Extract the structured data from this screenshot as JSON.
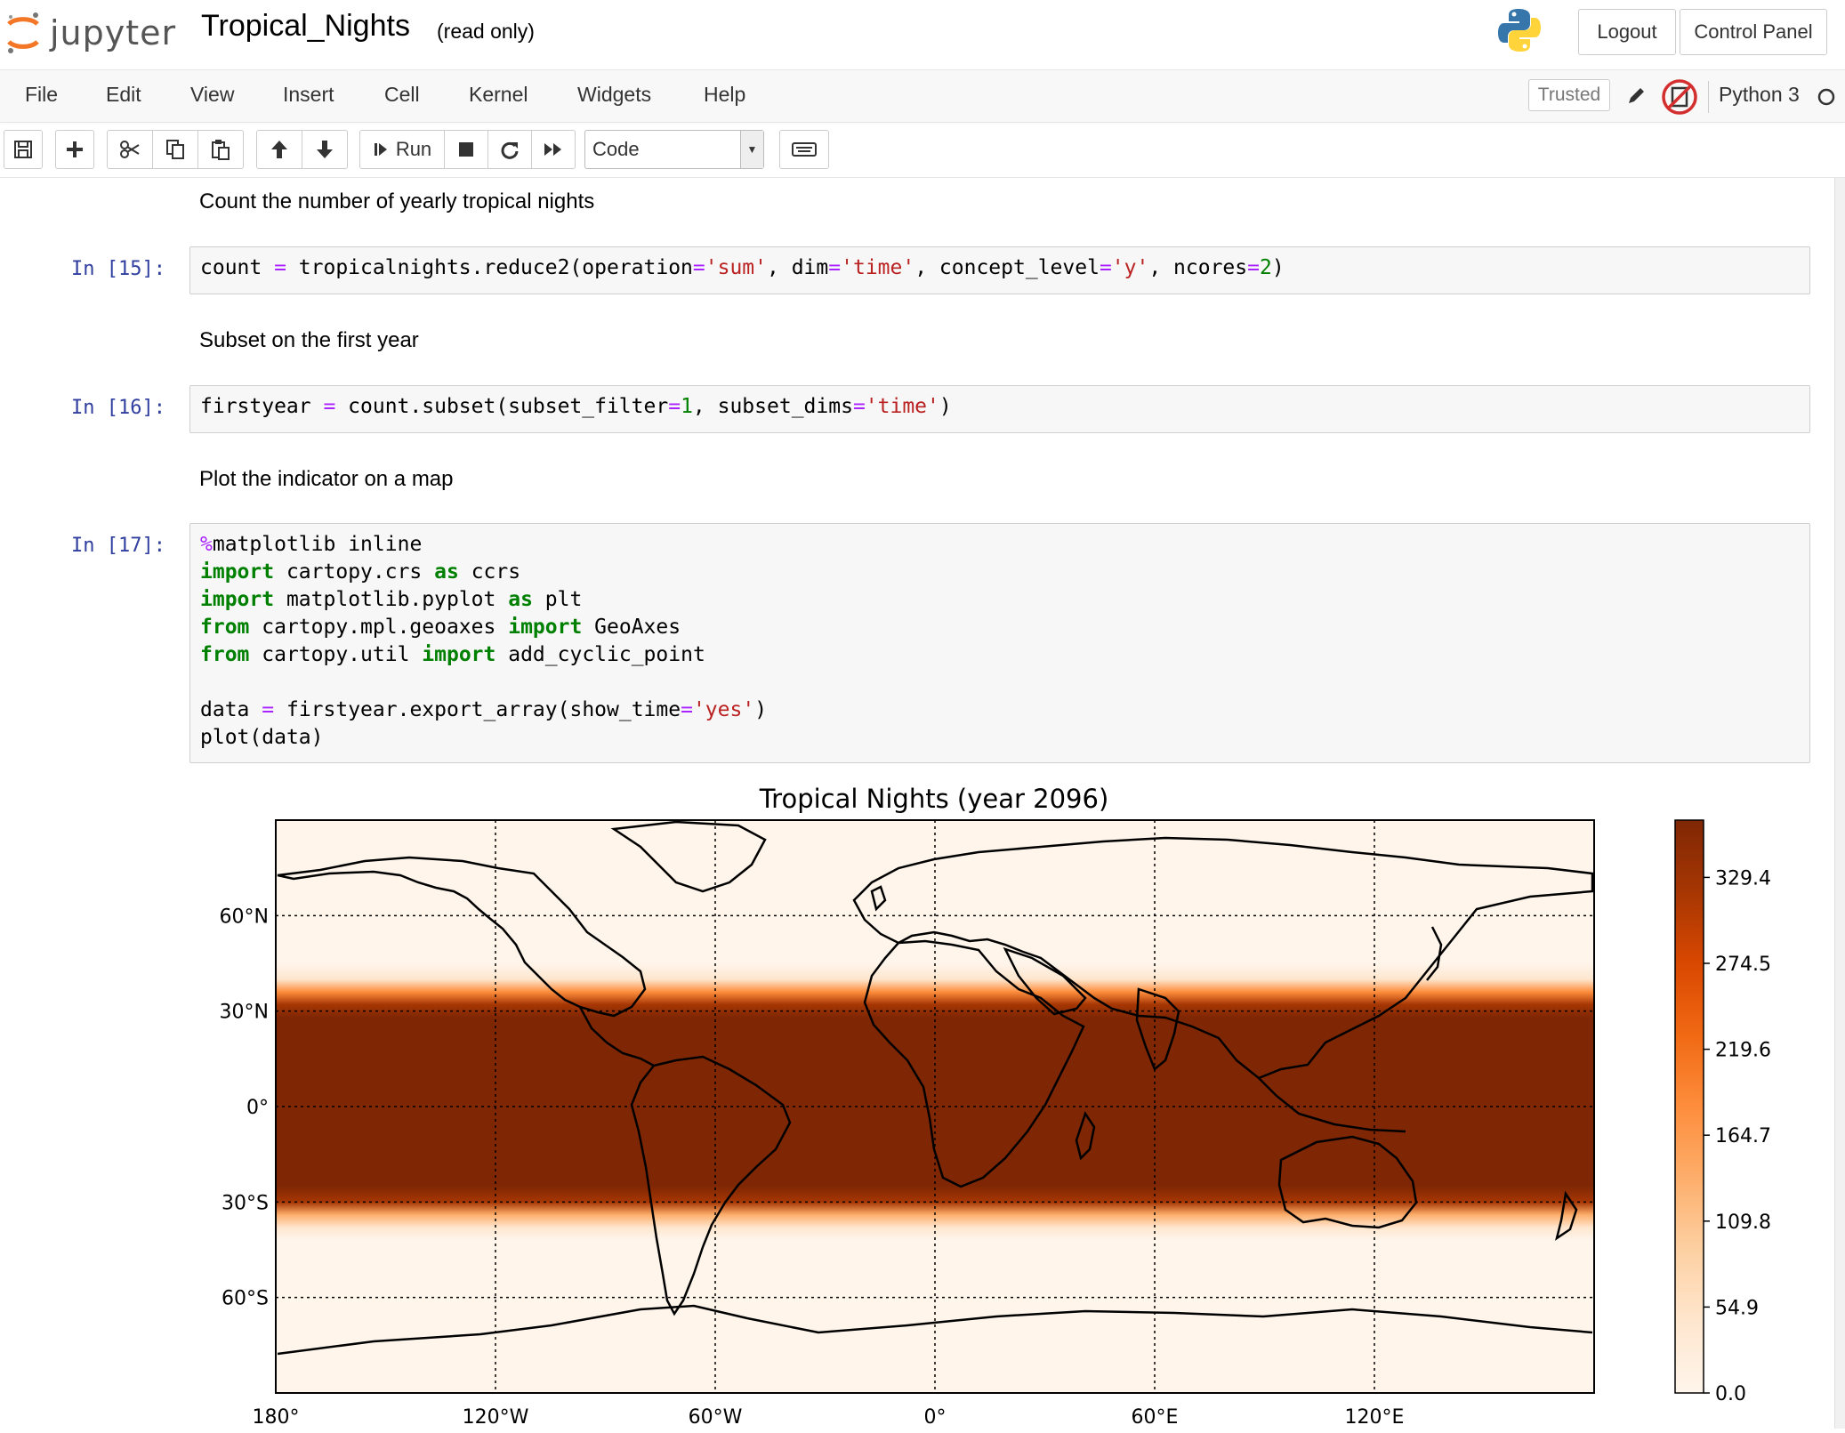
{
  "header": {
    "logo_text": "jupyter",
    "notebook_title": "Tropical_Nights",
    "read_only": "(read only)",
    "logout_label": "Logout",
    "control_panel_label": "Control Panel"
  },
  "menubar": {
    "items": [
      "File",
      "Edit",
      "View",
      "Insert",
      "Cell",
      "Kernel",
      "Widgets",
      "Help"
    ],
    "trusted_label": "Trusted",
    "kernel_name": "Python 3"
  },
  "toolbar": {
    "run_label": "Run",
    "cell_type": "Code"
  },
  "cells": {
    "md1": "Count the number of yearly tropical nights",
    "prompt15": "In [15]:",
    "md2": "Subset on the first year",
    "prompt16": "In [16]:",
    "md3": "Plot the indicator on a map",
    "prompt17": "In [17]:"
  },
  "code": {
    "c15": [
      "count",
      " = ",
      "tropicalnights.reduce2(operation",
      "=",
      "'sum'",
      ", dim",
      "=",
      "'time'",
      ", concept_level",
      "=",
      "'y'",
      ", ncores",
      "=",
      "2",
      ")"
    ],
    "c16": [
      "firstyear",
      " = ",
      "count.subset(subset_filter",
      "=",
      "1",
      ", subset_dims",
      "=",
      "'time'",
      ")"
    ],
    "c17_lines": [
      "%matplotlib inline",
      "import cartopy.crs as ccrs",
      "import matplotlib.pyplot as plt",
      "from cartopy.mpl.geoaxes import GeoAxes",
      "from cartopy.util import add_cyclic_point",
      "",
      "data = firstyear.export_array(show_time='yes')",
      "plot(data)"
    ]
  },
  "chart_data": {
    "type": "heatmap",
    "title": "Tropical Nights (year 2096)",
    "x_ticks": [
      "180°",
      "120°W",
      "60°W",
      "0°",
      "60°E",
      "120°E"
    ],
    "y_ticks": [
      "60°N",
      "30°N",
      "0°",
      "30°S",
      "60°S"
    ],
    "x_range": [
      -180,
      180
    ],
    "y_range": [
      -90,
      90
    ],
    "colorbar_ticks": [
      "329.4",
      "274.5",
      "219.6",
      "164.7",
      "109.8",
      "54.9",
      "0.0"
    ],
    "colorbar_range": [
      0,
      366
    ],
    "colormap": [
      "#fff5eb",
      "#fee6ce",
      "#fdd0a2",
      "#fdae6b",
      "#fd8d3c",
      "#f16913",
      "#d94801",
      "#a63603",
      "#7f2704"
    ],
    "zonal_profile": [
      {
        "lat": 90,
        "value": 0
      },
      {
        "lat": 45,
        "value": 0
      },
      {
        "lat": 40,
        "value": 40
      },
      {
        "lat": 36,
        "value": 180
      },
      {
        "lat": 32,
        "value": 300
      },
      {
        "lat": 28,
        "value": 350
      },
      {
        "lat": 0,
        "value": 365
      },
      {
        "lat": -25,
        "value": 350
      },
      {
        "lat": -30,
        "value": 300
      },
      {
        "lat": -34,
        "value": 160
      },
      {
        "lat": -38,
        "value": 40
      },
      {
        "lat": -42,
        "value": 0
      },
      {
        "lat": -90,
        "value": 0
      }
    ],
    "grid": true
  }
}
